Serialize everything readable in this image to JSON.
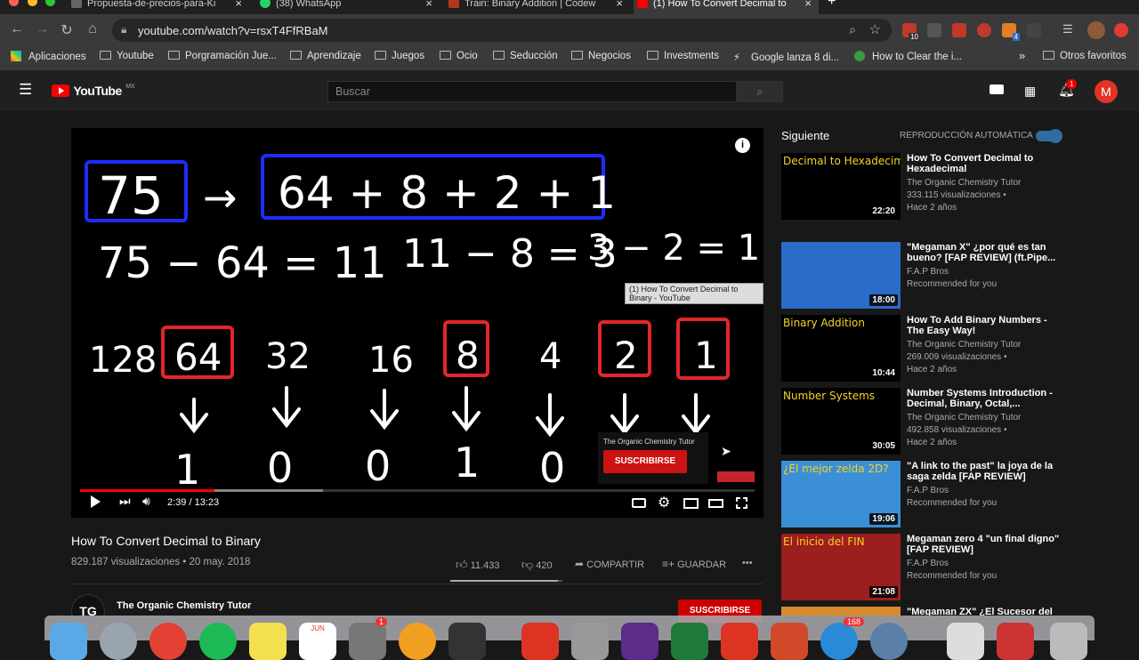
{
  "browser": {
    "tabs": [
      {
        "title": "Propuesta-de-precios-para-Ki",
        "active": false
      },
      {
        "title": "(38) WhatsApp",
        "active": false
      },
      {
        "title": "Train: Binary Addition | Codew",
        "active": false
      },
      {
        "title": "(1) How To Convert Decimal to",
        "active": true
      }
    ],
    "new_tab": "+",
    "url": "youtube.com/watch?v=rsxT4FfRBaM",
    "badge_ext": "10",
    "badge_ext2": "4"
  },
  "bookmarks": {
    "items": [
      "Aplicaciones",
      "Youtube",
      "Porgramación Jue...",
      "Aprendizaje",
      "Juegos",
      "Ocio",
      "Seducción",
      "Negocios",
      "Investments",
      "Google lanza 8 di...",
      "How to Clear the i..."
    ],
    "more": "»",
    "other": "Otros favoritos"
  },
  "youtube": {
    "logo": "YouTube",
    "region": "MX",
    "search_placeholder": "Buscar",
    "notifications": "1",
    "avatar": "M"
  },
  "player": {
    "board_top_left": "75",
    "board_arrow": "→",
    "board_top_right": "64 + 8 + 2 + 1",
    "line2_a": "75 − 64 = 11",
    "line2_b": "11 − 8 = 3",
    "line2_c": "3 − 2 = 1",
    "powers": [
      "128",
      "64",
      "32",
      "16",
      "8",
      "4",
      "2",
      "1"
    ],
    "bits": [
      "1",
      "0",
      "0",
      "1",
      "0"
    ],
    "tooltip": "(1) How To Convert Decimal to Binary - YouTube",
    "sub_channel": "The Organic Chemistry Tutor",
    "sub_button": "SUSCRIBIRSE",
    "time": "2:39 / 13:23",
    "progress": 0.199,
    "buffered": 0.36
  },
  "video": {
    "title": "How To Convert Decimal to Binary",
    "meta": "829.187 visualizaciones • 20 may. 2018",
    "likes": "11.433",
    "dislikes": "420",
    "share": "COMPARTIR",
    "save": "GUARDAR",
    "more": "•••",
    "channel_avatar": "TG",
    "channel": "The Organic Chemistry Tutor",
    "subscribe": "SUSCRIBIRSE"
  },
  "sidebar": {
    "next": "Siguiente",
    "autoplay": "REPRODUCCIÓN AUTOMÁTICA",
    "items": [
      {
        "title": "How To Convert Decimal to Hexadecimal",
        "channel": "The Organic Chemistry Tutor",
        "views": "333.115 visualizaciones •",
        "age": "Hace 2 años",
        "duration": "22:20",
        "thumb_title": "Decimal to Hexadecimal",
        "thumb_bg": "#000000"
      },
      {
        "title": "\"Megaman X\" ¿por qué es tan bueno? [FAP REVIEW] (ft.Pipe...",
        "channel": "F.A.P Bros",
        "views": "Recommended for you",
        "age": "",
        "duration": "18:00",
        "thumb_title": "",
        "thumb_bg": "#2a6cc9"
      },
      {
        "title": "How To Add Binary Numbers - The Easy Way!",
        "channel": "The Organic Chemistry Tutor",
        "views": "269.009 visualizaciones •",
        "age": "Hace 2 años",
        "duration": "10:44",
        "thumb_title": "Binary Addition",
        "thumb_bg": "#000000"
      },
      {
        "title": "Number Systems Introduction - Decimal, Binary, Octal,...",
        "channel": "The Organic Chemistry Tutor",
        "views": "492.858 visualizaciones •",
        "age": "Hace 2 años",
        "duration": "30:05",
        "thumb_title": "Number Systems",
        "thumb_bg": "#000000"
      },
      {
        "title": "\"A link to the past\" la joya de la saga zelda [FAP REVIEW]",
        "channel": "F.A.P Bros",
        "views": "Recommended for you",
        "age": "",
        "duration": "19:06",
        "thumb_title": "¿El mejor zelda 2D?",
        "thumb_bg": "#3b8fd6"
      },
      {
        "title": "Megaman zero 4 \"un final digno\" [FAP REVIEW]",
        "channel": "F.A.P Bros",
        "views": "Recommended for you",
        "age": "",
        "duration": "21:08",
        "thumb_title": "El inicio del FIN",
        "thumb_bg": "#9b1f1f"
      },
      {
        "title": "\"Megaman ZX\" ¿El Sucesor del",
        "channel": "",
        "views": "",
        "age": "",
        "duration": "",
        "thumb_title": "",
        "thumb_bg": "#d88a2a"
      }
    ]
  },
  "dock": {
    "badge_a": "1",
    "badge_b": "168",
    "calendar_month": "JUN"
  }
}
